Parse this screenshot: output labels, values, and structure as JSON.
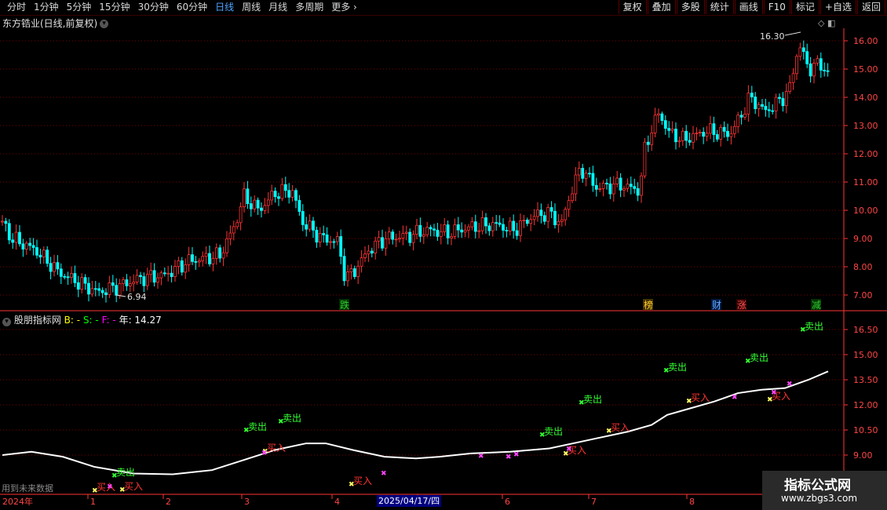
{
  "toolbar": {
    "periods": [
      "分时",
      "1分钟",
      "5分钟",
      "15分钟",
      "30分钟",
      "60分钟",
      "日线",
      "周线",
      "月线",
      "多周期",
      "更多"
    ],
    "active_period": "日线",
    "right_buttons": [
      "复权",
      "叠加",
      "多股",
      "统计",
      "画线",
      "F10",
      "标记",
      "+自选",
      "返回"
    ]
  },
  "main_chart": {
    "title": "东方锆业(日线,前复权)",
    "high_label": "16.30",
    "low_label": "6.94",
    "y_ticks": [
      "16.00",
      "15.00",
      "14.00",
      "13.00",
      "12.00",
      "11.00",
      "10.00",
      "9.00",
      "8.00",
      "7.00"
    ],
    "markers": [
      {
        "text": "跌",
        "color": "#33cc33",
        "bg": "#003300"
      },
      {
        "text": "榜",
        "color": "#ffcc33",
        "bg": "#443300"
      },
      {
        "text": "财",
        "color": "#66aaff",
        "bg": "#001a44"
      },
      {
        "text": "涨",
        "color": "#ff5555",
        "bg": "#330000"
      },
      {
        "text": "减",
        "color": "#33cc33",
        "bg": "#003300"
      }
    ]
  },
  "indicator": {
    "name": "股朋指标网",
    "b_label": "B: -",
    "s_label": "S: -",
    "f_label": "F: -",
    "year_label": "年: 14.27",
    "y_ticks": [
      "16.50",
      "15.00",
      "13.50",
      "12.00",
      "10.50",
      "9.00"
    ],
    "buy_text": "买入",
    "sell_text": "卖出"
  },
  "x_axis": {
    "labels": [
      "2024年",
      "1",
      "2",
      "3",
      "4",
      "5",
      "6",
      "7",
      "8"
    ],
    "cursor_date": "2025/04/17/四"
  },
  "footer": {
    "future_text": "用到未来数据"
  },
  "watermark": {
    "title": "指标公式网",
    "url": "www.zbgs3.com"
  },
  "colors": {
    "up": "#ff3333",
    "down": "#00ffff",
    "grid": "#7a0000",
    "axis": "#ff3333"
  }
}
